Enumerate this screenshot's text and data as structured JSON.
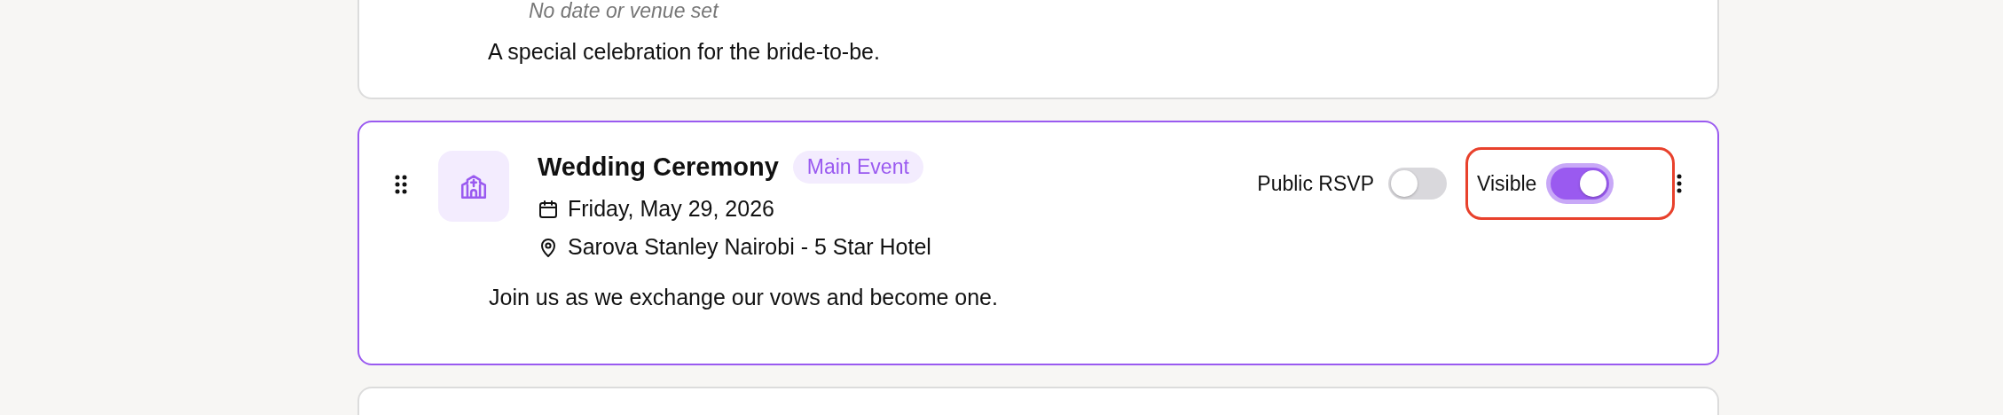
{
  "events": [
    {
      "kind": "tail",
      "note": "No date or venue set",
      "description": "A special celebration for the bride-to-be.",
      "selected": false
    },
    {
      "kind": "full",
      "selected": true,
      "title": "Wedding Ceremony",
      "badge": "Main Event",
      "date": "Friday, May 29, 2026",
      "location": "Sarova Stanley Nairobi - 5 Star Hotel",
      "description": "Join us as we exchange our vows and become one.",
      "toggles": [
        {
          "label": "Public RSVP",
          "on": false,
          "highlighted": false
        },
        {
          "label": "Visible",
          "on": true,
          "highlighted": true
        }
      ]
    },
    {
      "kind": "head",
      "selected": false
    }
  ]
}
